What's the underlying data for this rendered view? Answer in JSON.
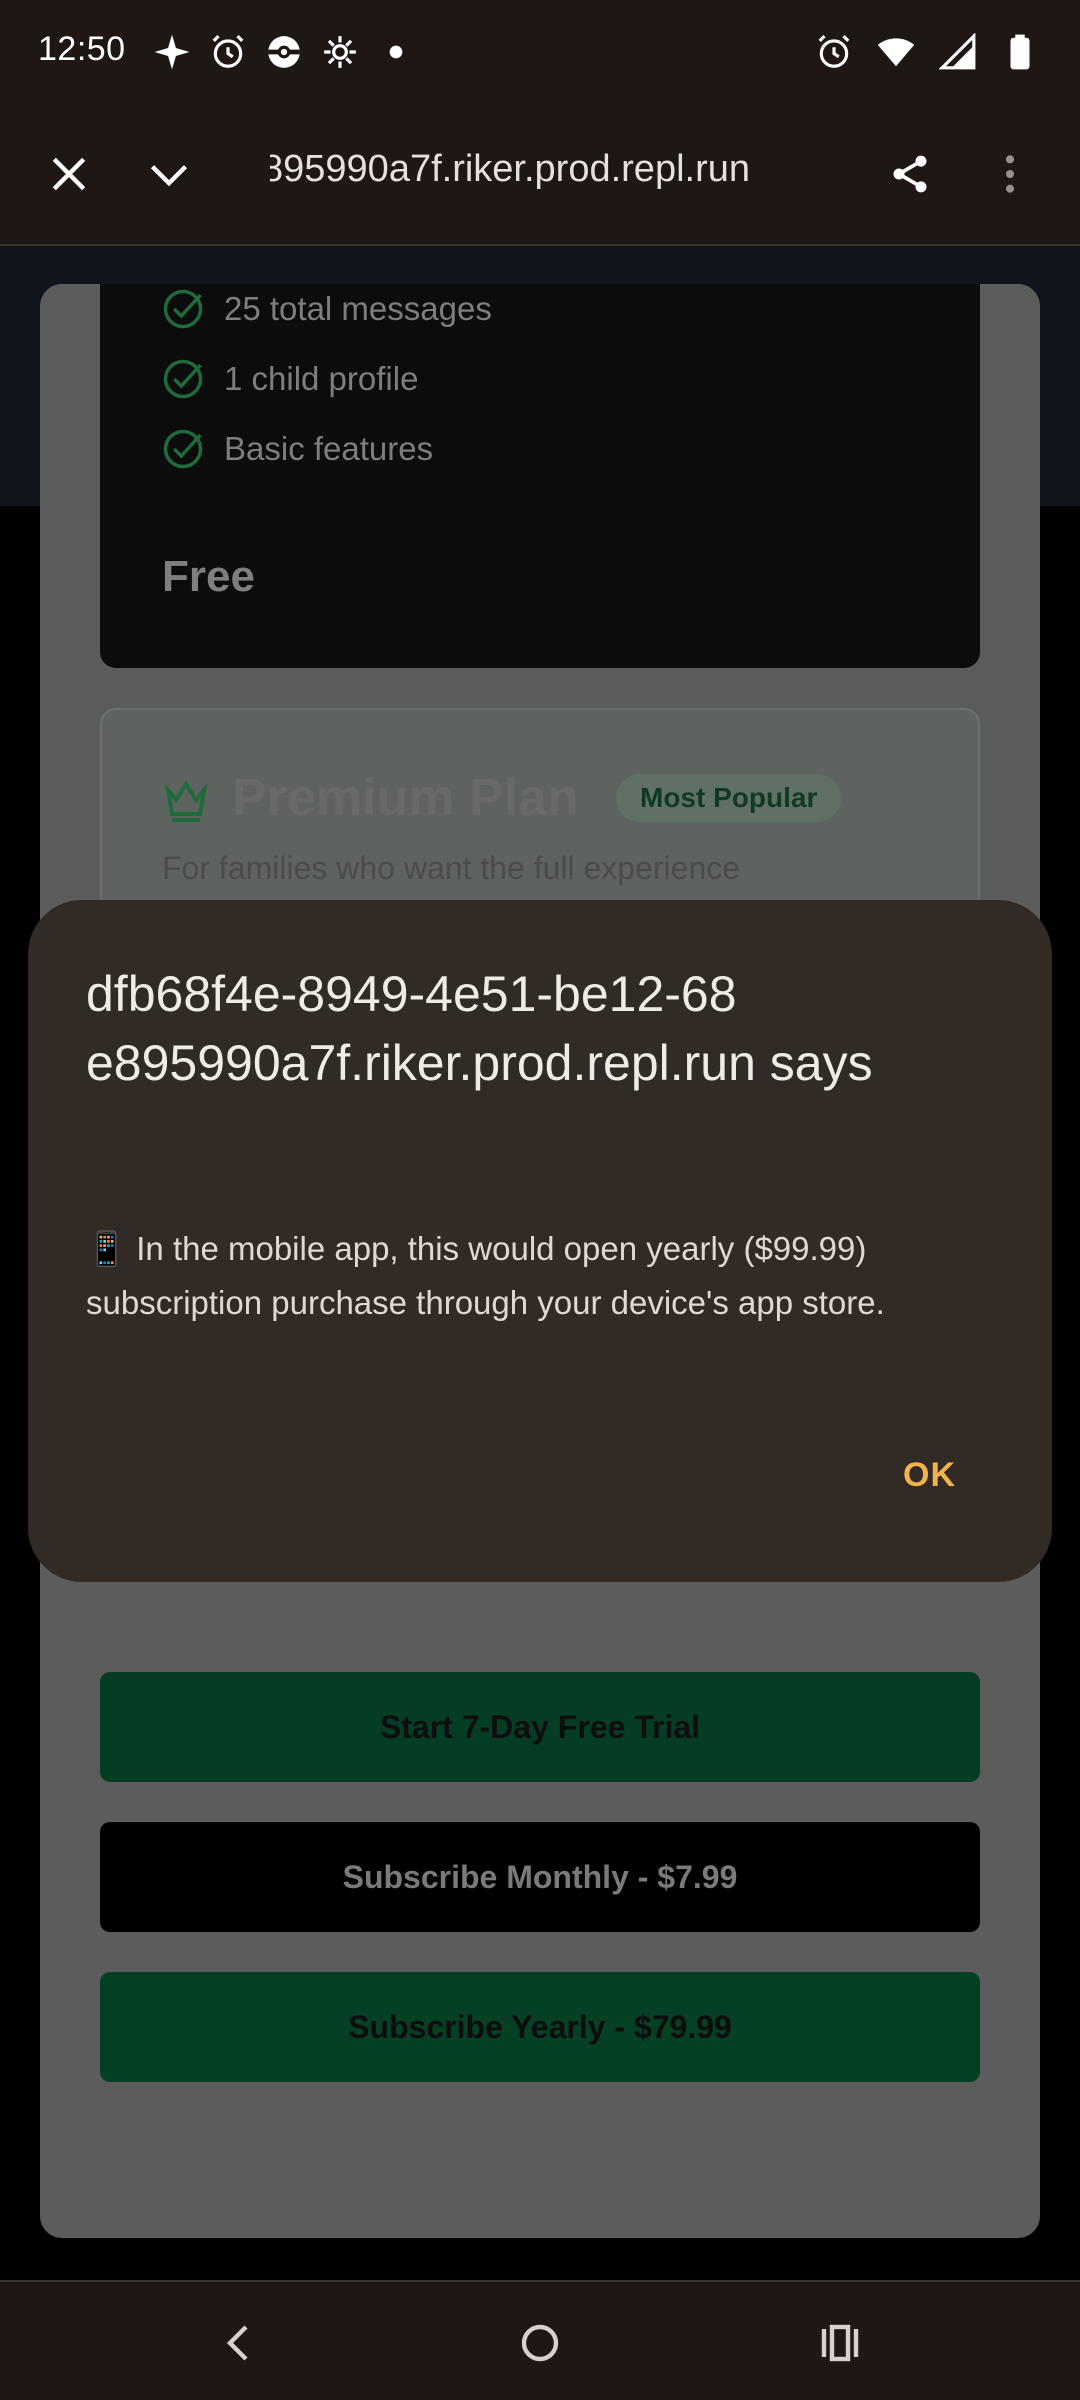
{
  "status_bar": {
    "time": "12:50",
    "left_icons": [
      "sparkle-icon",
      "alarm-icon",
      "pokeball-icon",
      "gear-flower-icon",
      "dot-icon"
    ],
    "right_icons": [
      "alarm-icon",
      "wifi-icon",
      "signal-icon",
      "battery-icon"
    ]
  },
  "browser": {
    "url": "dfb68f4e-8949-4e51-be12-68e895990a7f.riker.prod.repl.run",
    "url_visible": "990a7f.riker.prod.repl.run"
  },
  "page": {
    "free_plan": {
      "features": [
        "25 total messages",
        "1 child profile",
        "Basic features"
      ],
      "price_label": "Free"
    },
    "premium_plan": {
      "title": "Premium Plan",
      "badge": "Most Popular",
      "description": "For families who want the full experience"
    },
    "buttons": {
      "trial": "Start 7-Day Free Trial",
      "monthly": "Subscribe Monthly - $7.99",
      "yearly": "Subscribe Yearly - $79.99"
    }
  },
  "dialog": {
    "title": "dfb68f4e-8949-4e51-be12-68 e895990a7f.riker.prod.repl.run says",
    "message": "📱 In the mobile app, this would open yearly ($99.99) subscription purchase through your device's app store.",
    "ok_label": "OK"
  },
  "colors": {
    "accent_ok": "#f2b24c",
    "dialog_bg": "#322a24",
    "check_green": "#1f6b3c"
  }
}
